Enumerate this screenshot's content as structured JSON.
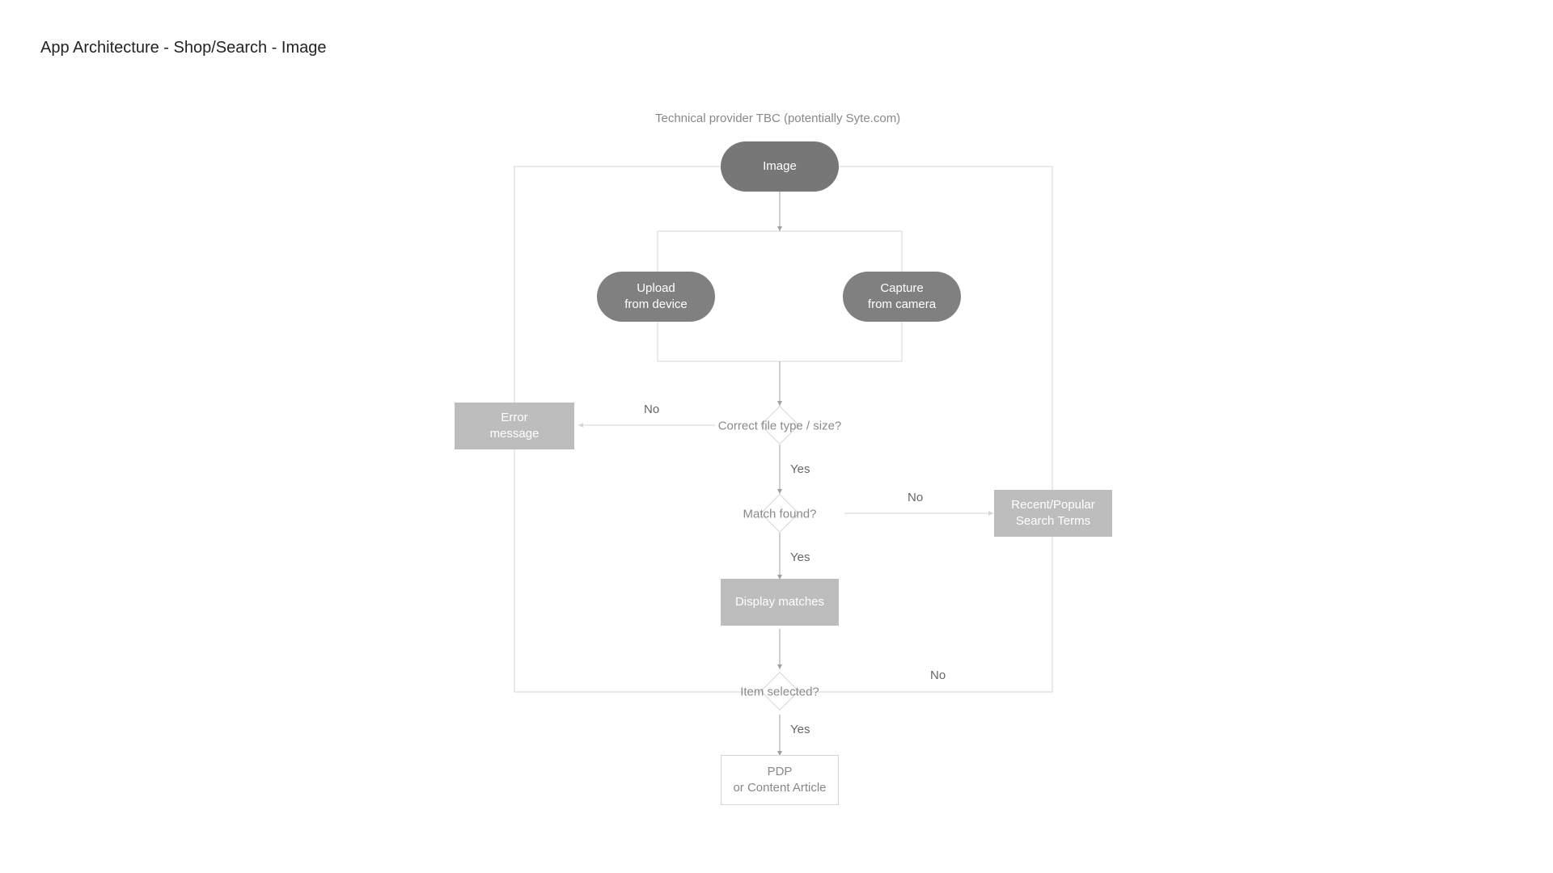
{
  "title": "App Architecture - Shop/Search - Image",
  "note_provider": "Technical provider TBC (potentially Syte.com)",
  "nodes": {
    "image": {
      "label": "Image"
    },
    "upload": {
      "line1": "Upload",
      "line2": "from device"
    },
    "capture": {
      "line1": "Capture",
      "line2": "from camera"
    },
    "check_file": {
      "label": "Correct file type / size?"
    },
    "error": {
      "line1": "Error",
      "line2": "message"
    },
    "match_found": {
      "label": "Match found?"
    },
    "recent_terms": {
      "line1": "Recent/Popular",
      "line2": "Search Terms"
    },
    "display": {
      "label": "Display matches"
    },
    "item_selected": {
      "label": "Item selected?"
    },
    "pdp": {
      "line1": "PDP",
      "line2": "or Content Article"
    }
  },
  "edge_labels": {
    "no": "No",
    "yes": "Yes"
  }
}
